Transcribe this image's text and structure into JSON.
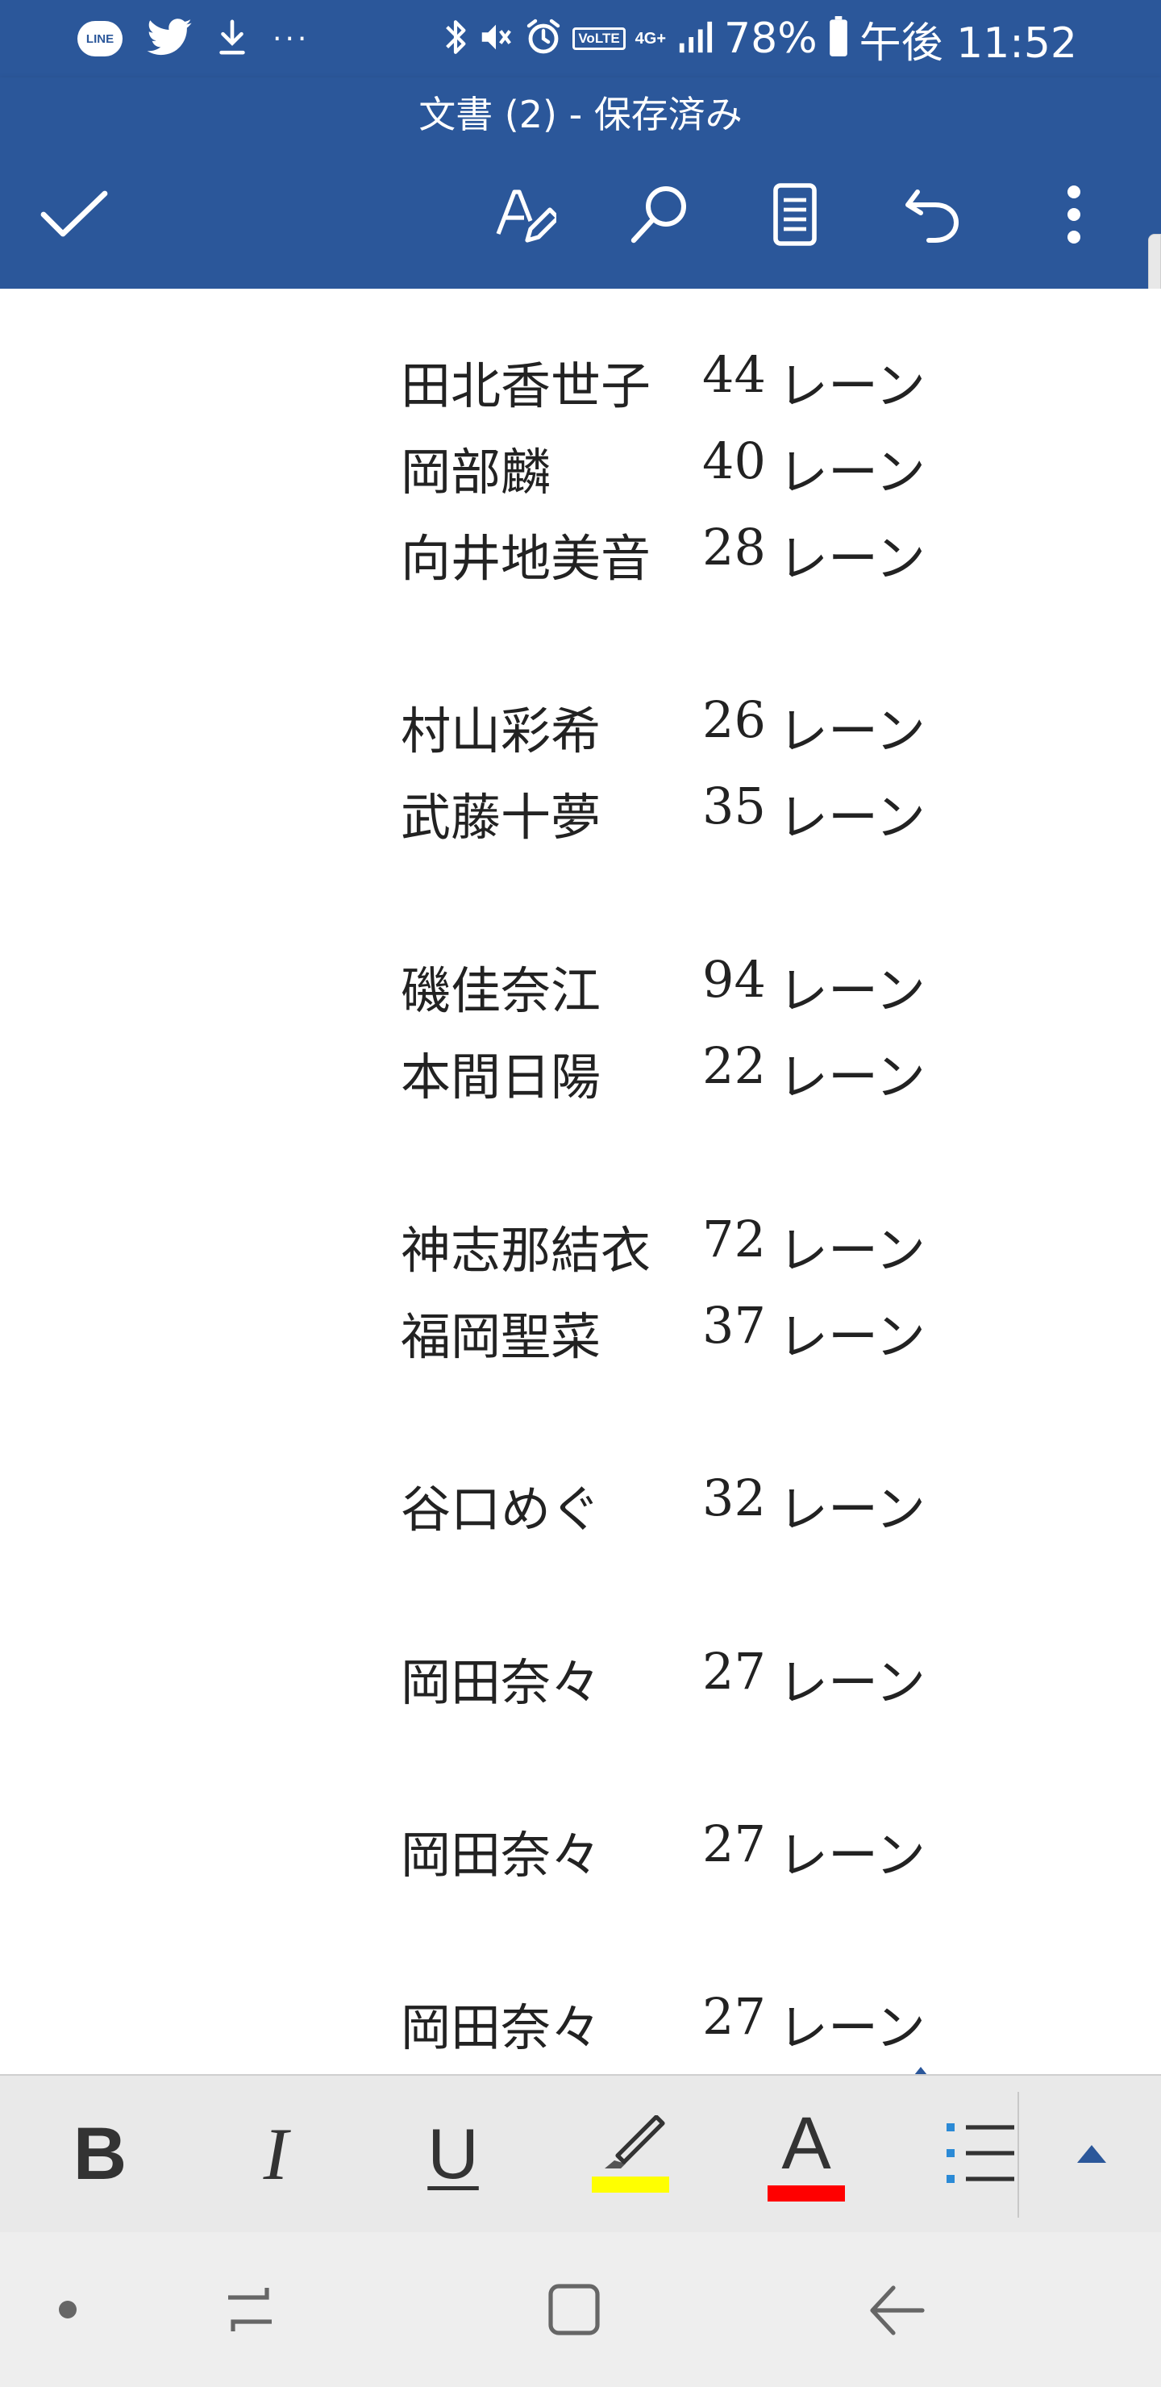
{
  "status_bar": {
    "line_label": "LINE",
    "dots": "···",
    "volte": "VoLTE",
    "network": "4G+",
    "battery": "78%",
    "time": "午後 11:52"
  },
  "header": {
    "doc_title": "文書 (2) - 保存済み"
  },
  "document": {
    "unit": "レーン",
    "entries": [
      {
        "name": "田北香世子",
        "value": "44"
      },
      {
        "name": "岡部麟",
        "value": "40"
      },
      {
        "name": "向井地美音",
        "value": "28"
      },
      {
        "name": "村山彩希",
        "value": "26"
      },
      {
        "name": "武藤十夢",
        "value": "35"
      },
      {
        "name": "磯佳奈江",
        "value": "94"
      },
      {
        "name": "本間日陽",
        "value": "22"
      },
      {
        "name": "神志那結衣",
        "value": "72"
      },
      {
        "name": "福岡聖菜",
        "value": "37"
      },
      {
        "name": "谷口めぐ",
        "value": "32"
      },
      {
        "name": "岡田奈々",
        "value": "27"
      },
      {
        "name": "岡田奈々",
        "value": "27"
      },
      {
        "name": "岡田奈々",
        "value": "27"
      }
    ]
  },
  "format_bar": {
    "bold": "B",
    "italic": "I",
    "underline": "U",
    "font_color_label": "A",
    "highlight_color": "#ffff00",
    "font_color": "#ff0000"
  },
  "colors": {
    "brand": "#2b579a",
    "text": "#222222"
  }
}
